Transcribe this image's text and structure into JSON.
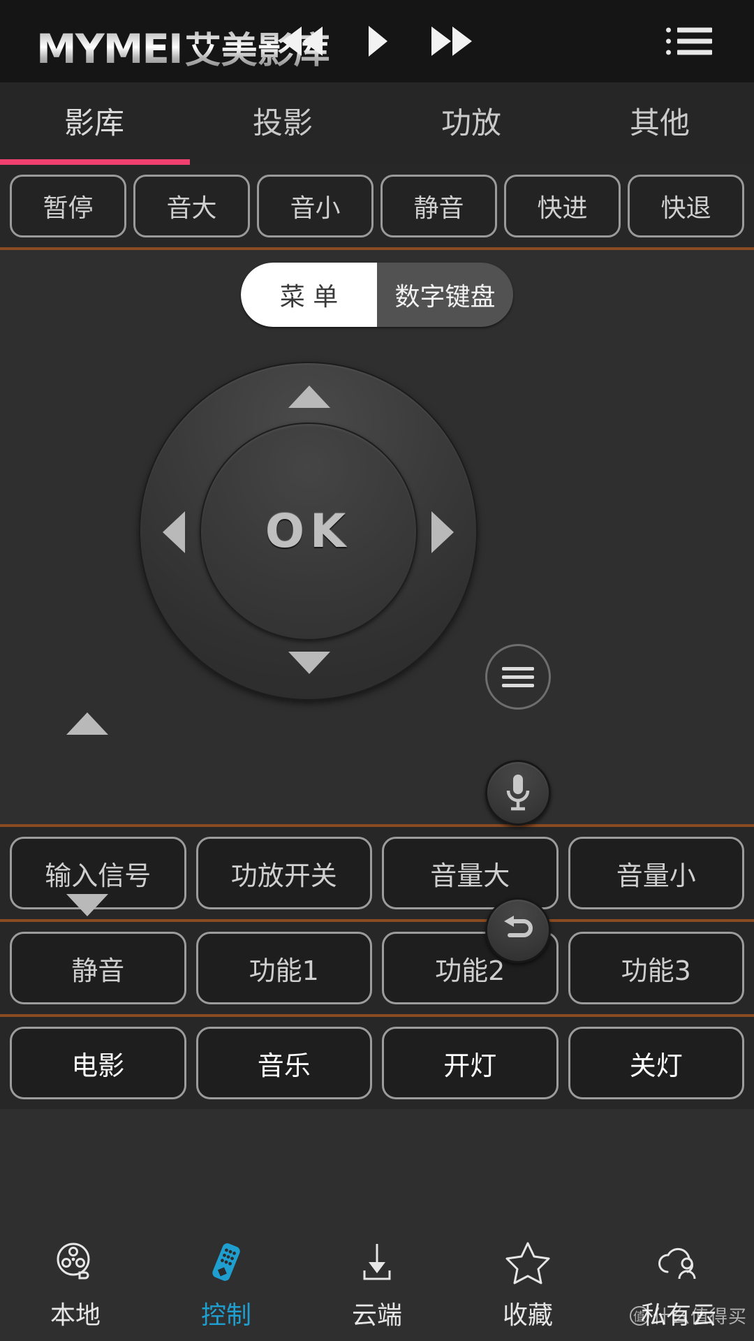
{
  "header": {
    "brand_latin": "MYMEI",
    "brand_cn": "艾美影库",
    "transport": {
      "rewind": "rewind-icon",
      "play": "play-icon",
      "forward": "fast-forward-icon"
    },
    "menu_icon": "list-menu-icon"
  },
  "tabs": {
    "active_index": 0,
    "accent_color": "#ef4070",
    "items": [
      {
        "label": "影库"
      },
      {
        "label": "投影"
      },
      {
        "label": "功放"
      },
      {
        "label": "其他"
      }
    ]
  },
  "top_buttons": [
    {
      "label": "暂停"
    },
    {
      "label": "音大"
    },
    {
      "label": "音小"
    },
    {
      "label": "静音"
    },
    {
      "label": "快进"
    },
    {
      "label": "快退"
    }
  ],
  "segmented": {
    "active_index": 0,
    "items": [
      {
        "label": "菜 单"
      },
      {
        "label": "数字键盘"
      }
    ]
  },
  "dpad": {
    "ok_label": "OK",
    "up": "arrow-up-icon",
    "down": "arrow-down-icon",
    "left": "arrow-left-icon",
    "right": "arrow-right-icon",
    "side_up": "page-up-icon",
    "side_down": "page-down-icon",
    "menu_button": "hamburger-menu-icon",
    "mic_button": "microphone-icon",
    "back_button": "back-return-icon"
  },
  "grids": {
    "divider_color": "#8a4b22",
    "row1": [
      {
        "label": "输入信号"
      },
      {
        "label": "功放开关"
      },
      {
        "label": "音量大"
      },
      {
        "label": "音量小"
      }
    ],
    "row2": [
      {
        "label": "静音"
      },
      {
        "label": "功能1"
      },
      {
        "label": "功能2"
      },
      {
        "label": "功能3"
      }
    ],
    "row3": [
      {
        "label": "电影"
      },
      {
        "label": "音乐"
      },
      {
        "label": "开灯"
      },
      {
        "label": "关灯"
      }
    ]
  },
  "bottom_nav": {
    "active_index": 1,
    "active_color": "#1f9fd0",
    "items": [
      {
        "label": "本地",
        "icon": "film-reel-icon"
      },
      {
        "label": "控制",
        "icon": "remote-control-icon"
      },
      {
        "label": "云端",
        "icon": "download-icon"
      },
      {
        "label": "收藏",
        "icon": "star-icon"
      },
      {
        "label": "私有云",
        "icon": "private-cloud-icon"
      }
    ]
  },
  "watermark": {
    "mark": "值",
    "text": "什么值得买"
  }
}
